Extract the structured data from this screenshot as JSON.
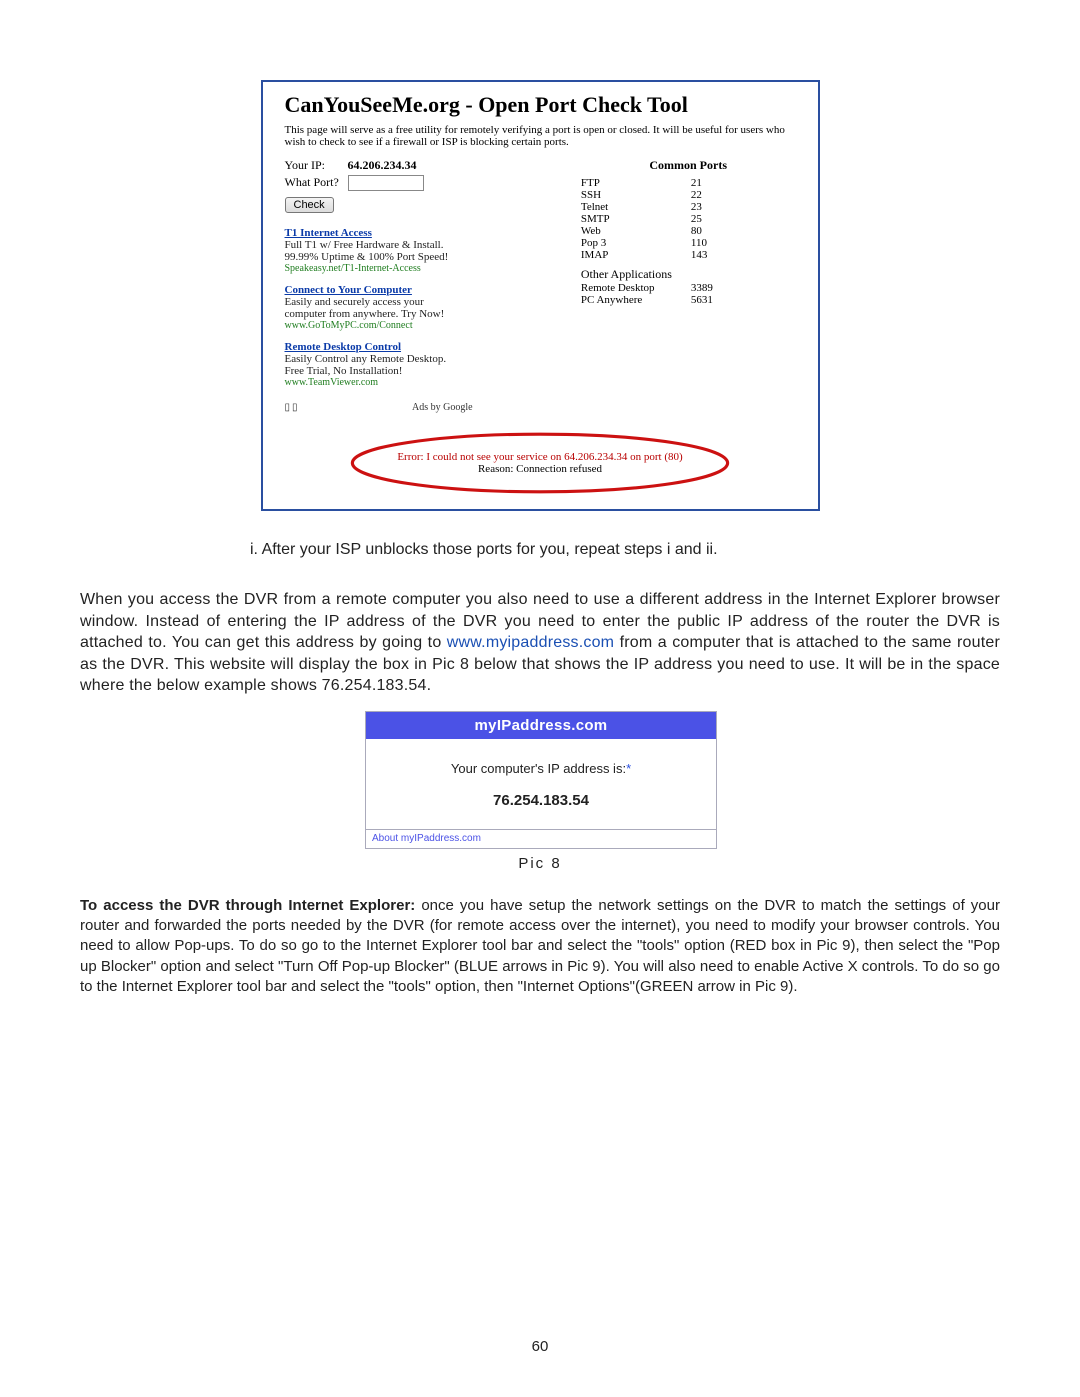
{
  "shot1": {
    "title": "CanYouSeeMe.org - Open Port Check Tool",
    "desc": "This page will serve as a free utility for remotely verifying a port is open or closed. It will be useful for users who wish to check to see if a firewall or ISP is blocking certain ports.",
    "your_ip_lbl": "Your IP:",
    "your_ip_val": "64.206.234.34",
    "what_port_lbl": "What Port?",
    "check_btn": "Check",
    "common_ports_hdr": "Common Ports",
    "ports": [
      {
        "name": "FTP",
        "num": "21"
      },
      {
        "name": "SSH",
        "num": "22"
      },
      {
        "name": "Telnet",
        "num": "23"
      },
      {
        "name": "SMTP",
        "num": "25"
      },
      {
        "name": "Web",
        "num": "80"
      },
      {
        "name": "Pop 3",
        "num": "110"
      },
      {
        "name": "IMAP",
        "num": "143"
      }
    ],
    "other_apps_hdr": "Other Applications",
    "other_apps": [
      {
        "name": "Remote Desktop",
        "num": "3389"
      },
      {
        "name": "PC Anywhere",
        "num": "5631"
      }
    ],
    "ads": [
      {
        "headline": "T1 Internet Access",
        "line1": "Full T1 w/ Free Hardware & Install.",
        "line2": "99.99% Uptime & 100% Port Speed!",
        "url": "Speakeasy.net/T1-Internet-Access"
      },
      {
        "headline": "Connect to Your Computer",
        "line1": "Easily and securely access your",
        "line2": "computer from anywhere. Try Now!",
        "url": "www.GoToMyPC.com/Connect"
      },
      {
        "headline": "Remote Desktop Control",
        "line1": "Easily Control any Remote Desktop.",
        "line2": "Free Trial, No Installation!",
        "url": "www.TeamViewer.com"
      }
    ],
    "ads_by": "Ads by Google",
    "error_prefix": "Error:",
    "error_msg": " I could not see your service on 64.206.234.34 on port (80)",
    "reason_lbl": "Reason:",
    "reason_val": " Connection refused"
  },
  "doc": {
    "line_i": "i.  After your ISP unblocks those ports for you, repeat steps i and ii.",
    "para1a": "When you access the DVR from a remote computer you also need to use a different address in the Internet Explorer browser window. Instead of entering the IP address of the DVR you need to enter the public IP address of the router the DVR is attached to. You can get this address by going to ",
    "para1_link": "www.myipaddress.com",
    "para1b": " from a computer that is attached to the same router as the DVR. This website will display the box in Pic 8 below that shows the IP address you need to use. It will be in the space where the below example shows 76.254.183.54."
  },
  "shot2": {
    "bar": "myIPaddress.com",
    "lead": "Your computer's IP address is:",
    "ip": "76.254.183.54",
    "footer": "About myIPaddress.com"
  },
  "pic8": "Pic 8",
  "final": {
    "lead": "To access the DVR through Internet Explorer:",
    "body": " once you have setup the network settings on the DVR to match the settings of your router and forwarded the ports needed by the DVR (for remote access over the internet), you need to modify your browser controls. You need to allow Pop-ups. To do so go to the Internet Explorer tool bar and select the \"tools\" option (RED box in Pic 9), then select the \"Pop up Blocker\" option and select \"Turn Off Pop-up Blocker\" (BLUE arrows in Pic 9). You will also need to enable Active X controls. To do so go to the Internet Explorer tool bar and select the \"tools\" option, then \"Internet Options\"(GREEN arrow in Pic 9)."
  },
  "page_number": "60"
}
